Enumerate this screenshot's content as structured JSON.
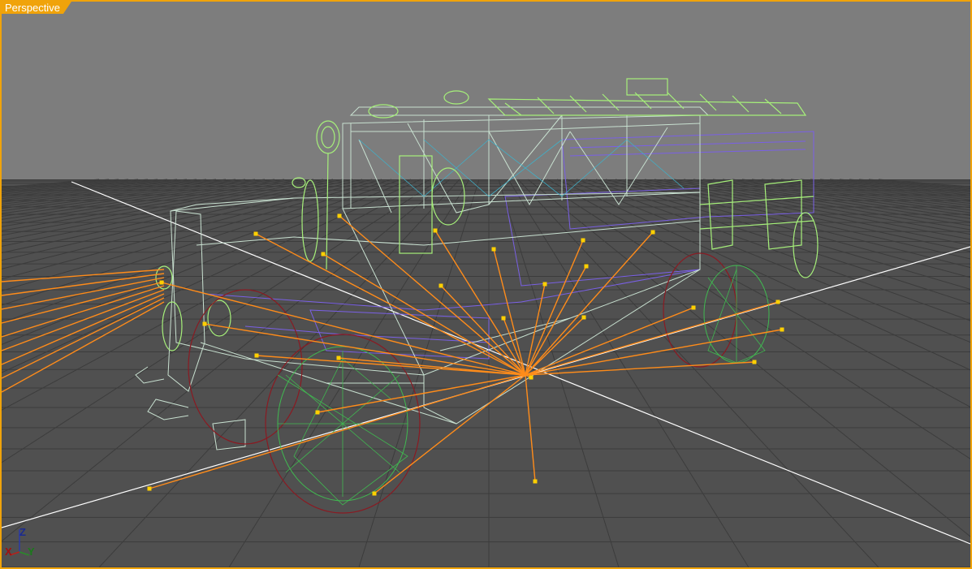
{
  "viewport": {
    "label": "Perspective",
    "view_type": "perspective",
    "shading": "wireframe",
    "active": true
  },
  "axis_gizmo": {
    "x_label": "X",
    "y_label": "Y",
    "z_label": "Z"
  },
  "colors": {
    "border": "#f0a30a",
    "background": "#7d7d7d",
    "ground_plane": "#505050",
    "grid_lines": "#3a3a3a",
    "world_axis": "#ffffff",
    "body_wire": "#c8e0d0",
    "green_parts": "#a6f07a",
    "purple_parts": "#7a60e6",
    "wheel_red": "#8a1a22",
    "wheel_green": "#40b850",
    "light_rays": "#ff8c1a",
    "light_points": "#ffd000",
    "cyan_wire": "#40b0c8"
  },
  "scene": {
    "model": "off-road vehicle",
    "light_count": 22
  }
}
